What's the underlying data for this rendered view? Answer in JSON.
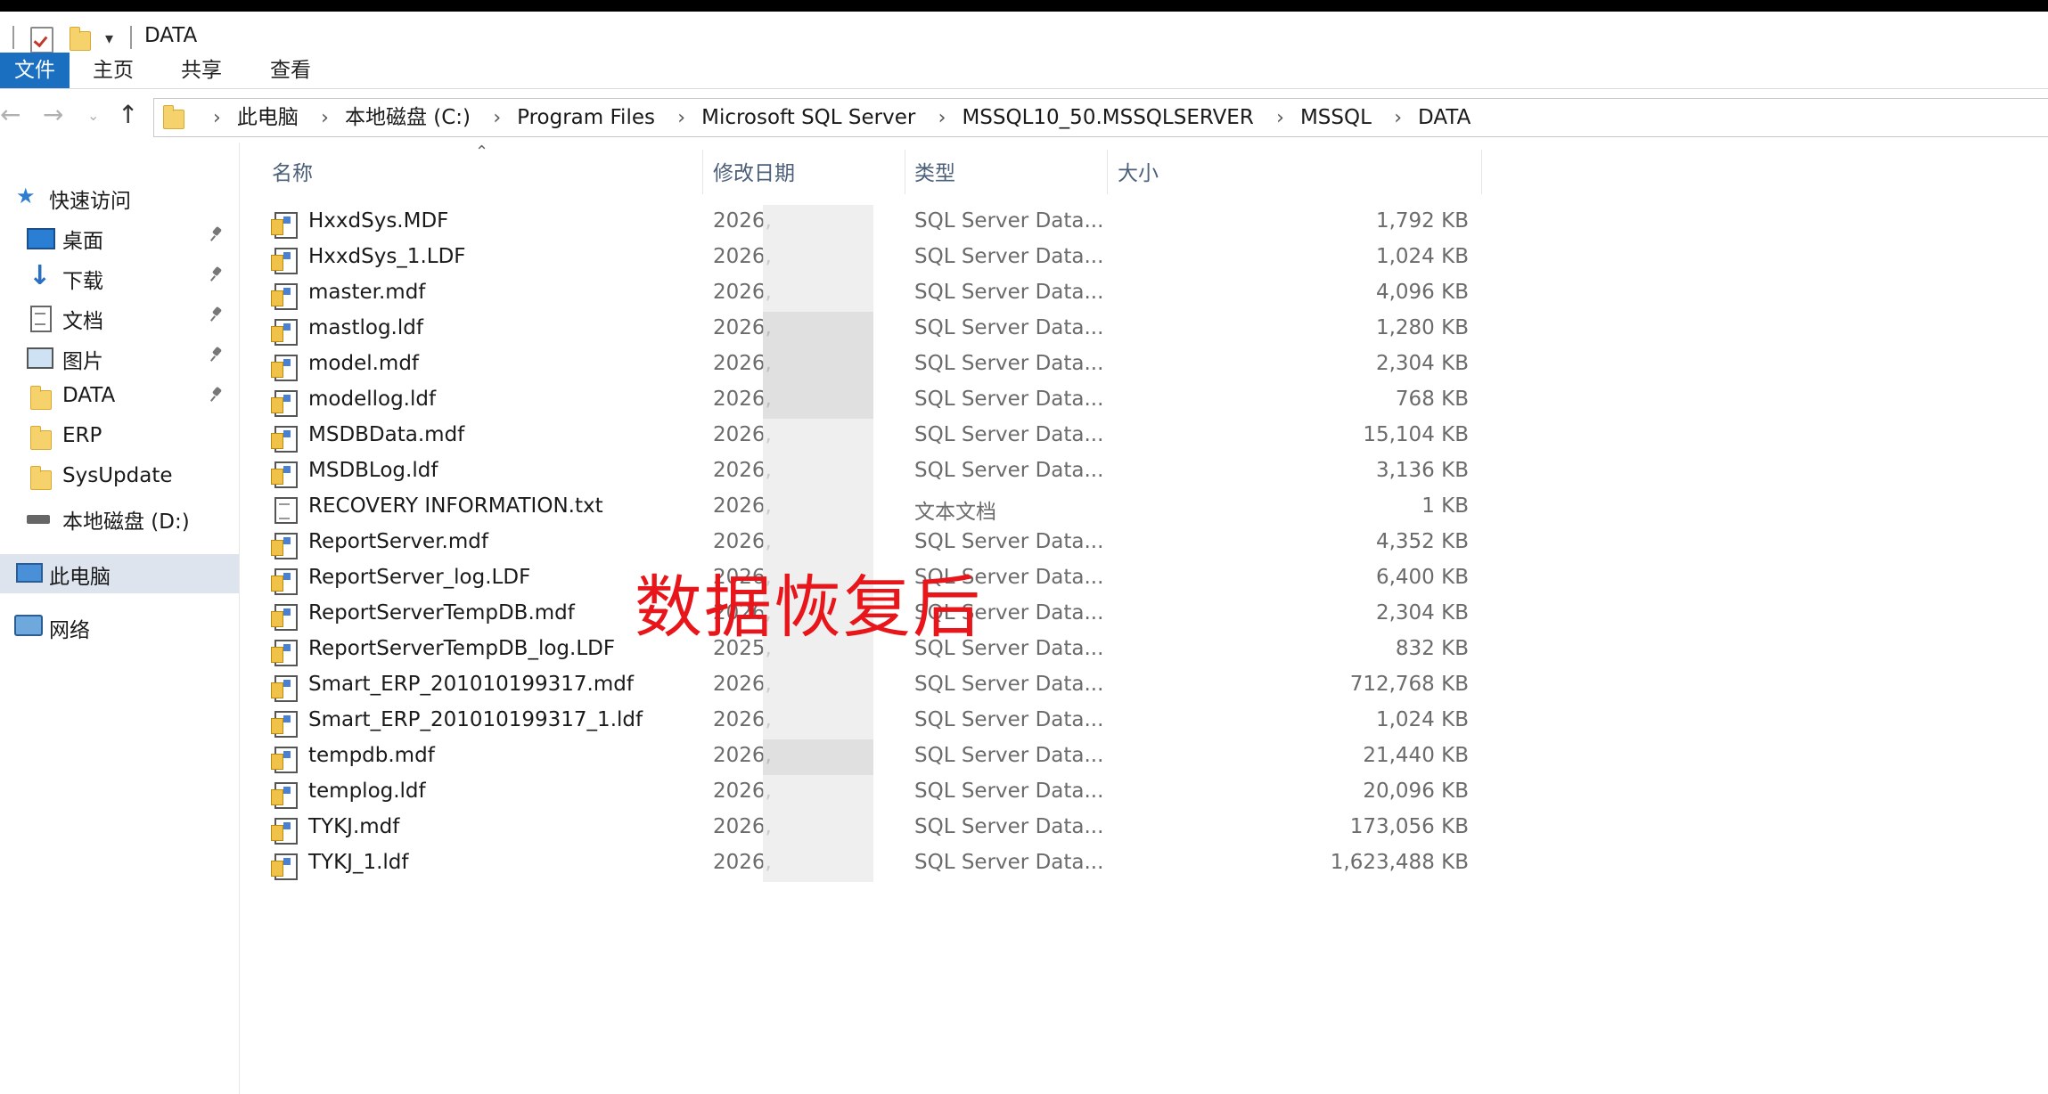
{
  "window": {
    "title": "DATA"
  },
  "ribbon": {
    "tabs": [
      "文件",
      "主页",
      "共享",
      "查看"
    ]
  },
  "address": {
    "crumbs": [
      "此电脑",
      "本地磁盘 (C:)",
      "Program Files",
      "Microsoft SQL Server",
      "MSSQL10_50.MSSQLSERVER",
      "MSSQL",
      "DATA"
    ]
  },
  "sidebar": {
    "quick_access": "快速访问",
    "items": [
      "桌面",
      "下载",
      "文档",
      "图片",
      "DATA",
      "ERP",
      "SysUpdate",
      "本地磁盘 (D:)"
    ],
    "this_pc": "此电脑",
    "network": "网络"
  },
  "columns": {
    "name": "名称",
    "date": "修改日期",
    "type": "类型",
    "size": "大小"
  },
  "files": [
    {
      "name": "HxxdSys.MDF",
      "date": "2026,",
      "type": "SQL Server Data...",
      "size": "1,792 KB",
      "icon": "database-file-icon"
    },
    {
      "name": "HxxdSys_1.LDF",
      "date": "2026,",
      "type": "SQL Server Data...",
      "size": "1,024 KB",
      "icon": "database-file-icon"
    },
    {
      "name": "master.mdf",
      "date": "2026,",
      "type": "SQL Server Data...",
      "size": "4,096 KB",
      "icon": "database-file-icon"
    },
    {
      "name": "mastlog.ldf",
      "date": "2026,",
      "type": "SQL Server Data...",
      "size": "1,280 KB",
      "icon": "database-file-icon"
    },
    {
      "name": "model.mdf",
      "date": "2026,",
      "type": "SQL Server Data...",
      "size": "2,304 KB",
      "icon": "database-file-icon"
    },
    {
      "name": "modellog.ldf",
      "date": "2026,",
      "type": "SQL Server Data...",
      "size": "768 KB",
      "icon": "database-file-icon"
    },
    {
      "name": "MSDBData.mdf",
      "date": "2026,",
      "type": "SQL Server Data...",
      "size": "15,104 KB",
      "icon": "database-file-icon"
    },
    {
      "name": "MSDBLog.ldf",
      "date": "2026,",
      "type": "SQL Server Data...",
      "size": "3,136 KB",
      "icon": "database-file-icon"
    },
    {
      "name": "RECOVERY INFORMATION.txt",
      "date": "2026,",
      "type": "文本文档",
      "size": "1 KB",
      "icon": "text-file-icon"
    },
    {
      "name": "ReportServer.mdf",
      "date": "2026,",
      "type": "SQL Server Data...",
      "size": "4,352 KB",
      "icon": "database-file-icon"
    },
    {
      "name": "ReportServer_log.LDF",
      "date": "2026,",
      "type": "SQL Server Data...",
      "size": "6,400 KB",
      "icon": "database-file-icon"
    },
    {
      "name": "ReportServerTempDB.mdf",
      "date": "2026,",
      "type": "SQL Server Data...",
      "size": "2,304 KB",
      "icon": "database-file-icon"
    },
    {
      "name": "ReportServerTempDB_log.LDF",
      "date": "2025,",
      "type": "SQL Server Data...",
      "size": "832 KB",
      "icon": "database-file-icon"
    },
    {
      "name": "Smart_ERP_201010199317.mdf",
      "date": "2026,",
      "type": "SQL Server Data...",
      "size": "712,768 KB",
      "icon": "database-file-icon"
    },
    {
      "name": "Smart_ERP_201010199317_1.ldf",
      "date": "2026,",
      "type": "SQL Server Data...",
      "size": "1,024 KB",
      "icon": "database-file-icon"
    },
    {
      "name": "tempdb.mdf",
      "date": "2026,",
      "type": "SQL Server Data...",
      "size": "21,440 KB",
      "icon": "database-file-icon"
    },
    {
      "name": "templog.ldf",
      "date": "2026,",
      "type": "SQL Server Data...",
      "size": "20,096 KB",
      "icon": "database-file-icon"
    },
    {
      "name": "TYKJ.mdf",
      "date": "2026,",
      "type": "SQL Server Data...",
      "size": "173,056 KB",
      "icon": "database-file-icon"
    },
    {
      "name": "TYKJ_1.ldf",
      "date": "2026,",
      "type": "SQL Server Data...",
      "size": "1,623,488 KB",
      "icon": "database-file-icon"
    }
  ],
  "overlay": {
    "text": "数据恢复后",
    "color": "#e8161a"
  },
  "colors": {
    "accent": "#1b6fc1",
    "selection": "#dde4ee"
  }
}
